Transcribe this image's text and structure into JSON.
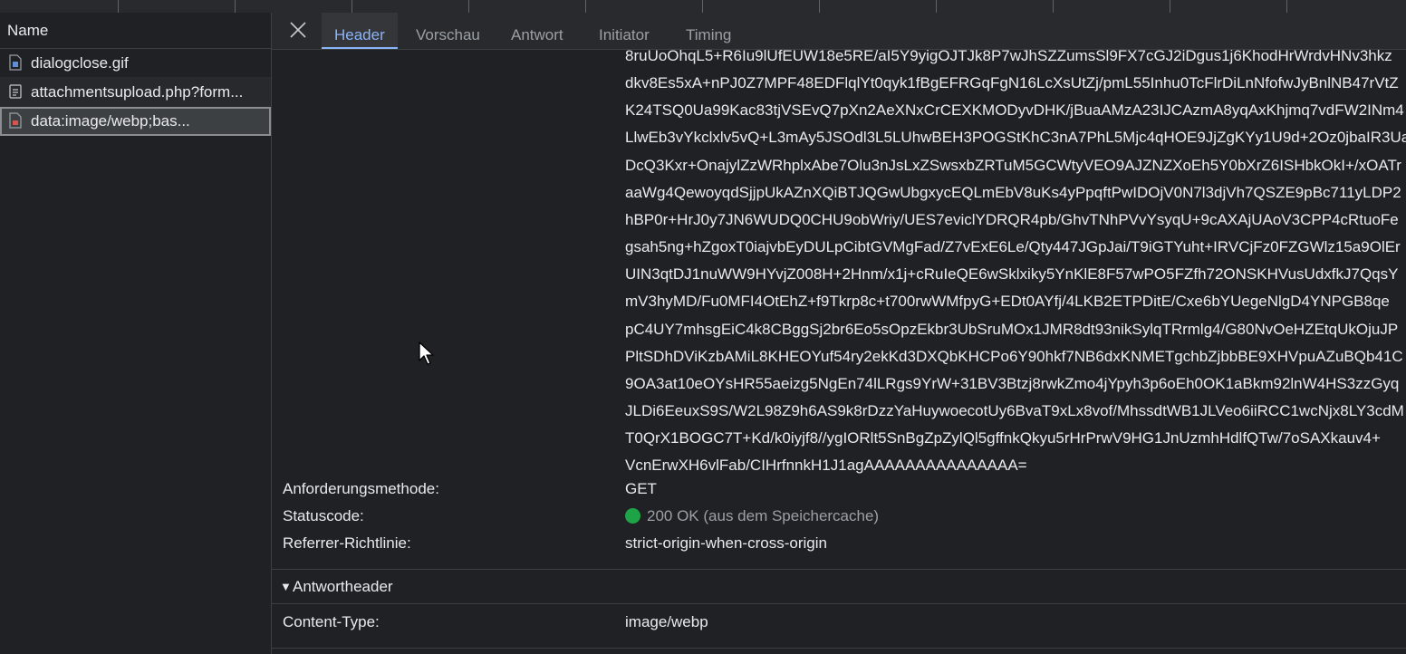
{
  "requests": {
    "header": "Name",
    "items": [
      {
        "name": "dialogclose.gif",
        "icon": "gif-file-icon"
      },
      {
        "name": "attachmentsupload.php?form...",
        "icon": "document-file-icon"
      },
      {
        "name": "data:image/webp;bas...",
        "icon": "image-file-icon"
      }
    ]
  },
  "tabs": [
    "Header",
    "Vorschau",
    "Antwort",
    "Initiator",
    "Timing"
  ],
  "active_tab": "Header",
  "base64_lines": [
    "8ruUoOhqL5+R6Iu9lUfEUW18e5RE/aI5Y9yigOJTJk8P7wJhSZZumsSl9FX7cGJ2iDgus1j6KhodHrWrdvHNv3hkz",
    "dkv8Es5xA+nPJ0Z7MPF48EDFlqlYt0qyk1fBgEFRGqFgN16LcXsUtZj/pmL55Inhu0TcFlrDiLnNfofwJyBnlNB47rVtZ",
    "K24TSQ0Ua99Kac83tjVSEvQ7pXn2AeXNxCrCEXKMODyvDHK/jBuaAMzA23IJCAzmA8yqAxKhjmq7vdFW2INm4",
    "LlwEb3vYkclxlv5vQ+L3mAy5JSOdl3L5LUhwBEH3POGStKhC3nA7PhL5Mjc4qHOE9JjZgKYy1U9d+2Oz0jbaIR3Ua",
    "DcQ3Kxr+OnajylZzWRhplxAbe7Olu3nJsLxZSwsxbZRTuM5GCWtyVEO9AJZNZXoEh5Y0bXrZ6ISHbkOkI+/xOATr",
    "aaWg4QewoyqdSjjpUkAZnXQiBTJQGwUbgxycEQLmEbV8uKs4yPpqftPwIDOjV0N7l3djVh7QSZE9pBc711yLDP2",
    "hBP0r+HrJ0y7JN6WUDQ0CHU9obWriy/UES7eviclYDRQR4pb/GhvTNhPVvYsyqU+9cAXAjUAoV3CPP4cRtuoFe",
    "gsah5ng+hZgoxT0iajvbEyDULpCibtGVMgFad/Z7vExE6Le/Qty447JGpJai/T9iGTYuht+IRVCjFz0FZGWlz15a9OlEr",
    "UIN3qtDJ1nuWW9HYvjZ008H+2Hnm/x1j+cRuIeQE6wSklxiky5YnKlE8F57wPO5FZfh72ONSKHVusUdxfkJ7QqsY",
    "mV3hyMD/Fu0MFI4OtEhZ+f9Tkrp8c+t700rwWMfpyG+EDt0AYfj/4LKB2ETPDitE/Cxe6bYUegeNlgD4YNPGB8qe",
    "pC4UY7mhsgEiC4k8CBggSj2br6Eo5sOpzEkbr3UbSruMOx1JMR8dt93nikSylqTRrmlg4/G80NvOeHZEtqUkOjuJP",
    "PltSDhDViKzbAMiL8KHEOYuf54ry2ekKd3DXQbKHCPo6Y90hkf7NB6dxKNMETgchbZjbbBE9XHVpuAZuBQb41C",
    "9OA3at10eOYsHR55aeizg5NgEn74lLRgs9YrW+31BV3Btzj8rwkZmo4jYpyh3p6oEh0OK1aBkm92lnW4HS3zzGyq",
    "JLDi6EeuxS9S/W2L98Z9h6AS9k8rDzzYaHuywoecotUy6BvaT9xLx8vof/MhssdtWB1JLVeo6iiRCC1wcNjx8LY3cdM",
    "T0QrX1BOGC7T+Kd/k0iyjf8//ygIORlt5SnBgZpZylQl5gffnkQkyu5rHrPrwV9HG1JnUzmhHdlfQTw/7oSAXkauv4+",
    "VcnErwXH6vlFab/CIHrfnnkH1J1agAAAAAAAAAAAAAAA="
  ],
  "general": {
    "method_label": "Anforderungsmethode:",
    "method_value": "GET",
    "status_label": "Statuscode:",
    "status_value": "200 OK (aus dem Speichercache)",
    "status_color": "#1ea446",
    "referrer_label": "Referrer-Richtlinie:",
    "referrer_value": "strict-origin-when-cross-origin"
  },
  "response_headers": {
    "title": "Antwortheader",
    "content_type_label": "Content-Type:",
    "content_type_value": "image/webp"
  },
  "colors": {
    "background": "#202124",
    "accent": "#8ab4f8",
    "muted_text": "#9aa0a6"
  }
}
